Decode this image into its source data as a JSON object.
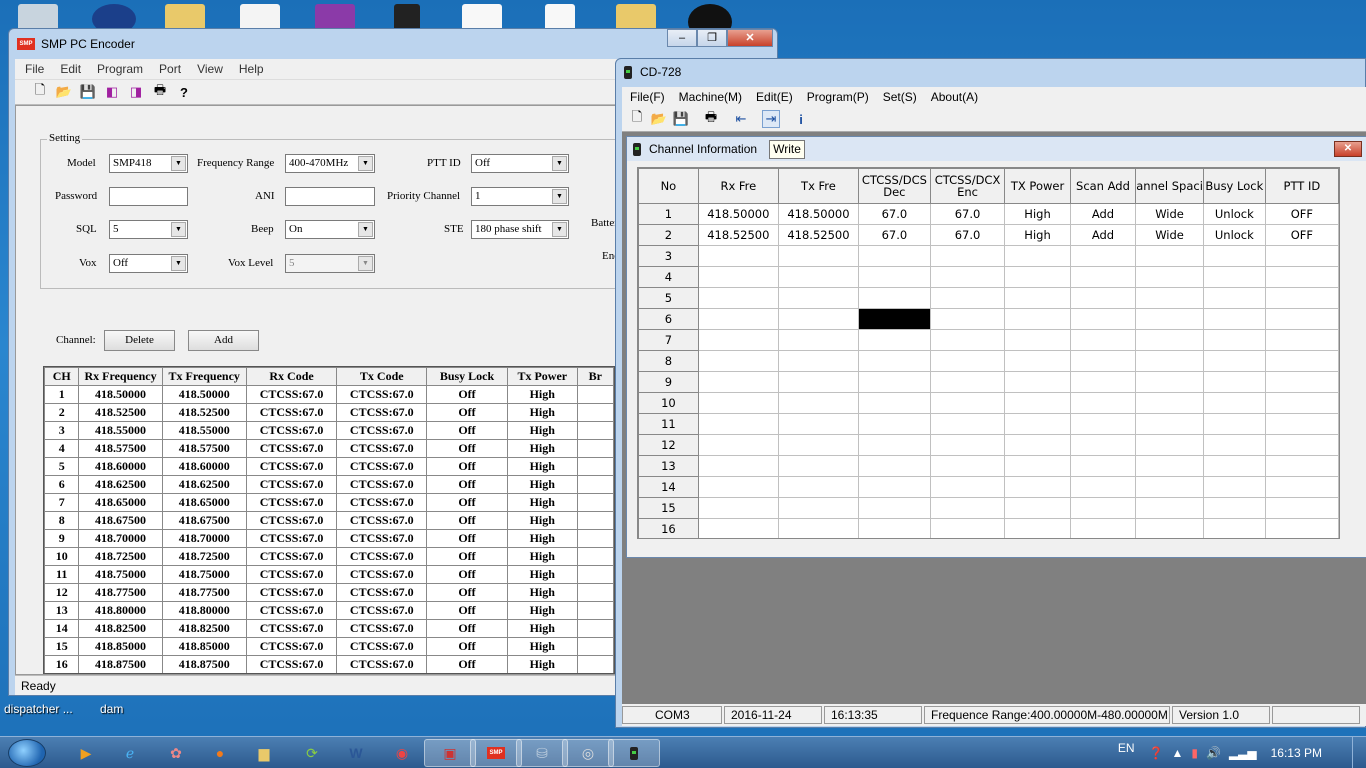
{
  "desktop": {
    "labels": [
      "dispatcher ...",
      "dam"
    ]
  },
  "smp": {
    "title": "SMP PC Encoder",
    "logo": "SMP",
    "menu": [
      "File",
      "Edit",
      "Program",
      "Port",
      "View",
      "Help"
    ],
    "setting_legend": "Setting",
    "model_label": "Model",
    "model_value": "SMP418",
    "freq_label": "Frequency Range",
    "freq_value": "400-470MHz",
    "pttid_label": "PTT ID",
    "pttid_value": "Off",
    "battery_label": "Battery",
    "password_label": "Password",
    "ani_label": "ANI",
    "priority_label": "Priority Channel",
    "priority_value": "1",
    "sql_label": "SQL",
    "sql_value": "5",
    "beep_label": "Beep",
    "beep_value": "On",
    "ste_label": "STE",
    "ste_value": "180 phase shift",
    "end_label": "End",
    "vox_label": "Vox",
    "vox_value": "Off",
    "voxlevel_label": "Vox Level",
    "voxlevel_value": "5",
    "channel_label": "Channel:",
    "delete_label": "Delete",
    "add_label": "Add",
    "columns": [
      "CH",
      "Rx Frequency",
      "Tx Frequency",
      "Rx Code",
      "Tx Code",
      "Busy Lock",
      "Tx Power",
      "Br"
    ],
    "rows": [
      [
        "1",
        "418.50000",
        "418.50000",
        "CTCSS:67.0",
        "CTCSS:67.0",
        "Off",
        "High"
      ],
      [
        "2",
        "418.52500",
        "418.52500",
        "CTCSS:67.0",
        "CTCSS:67.0",
        "Off",
        "High"
      ],
      [
        "3",
        "418.55000",
        "418.55000",
        "CTCSS:67.0",
        "CTCSS:67.0",
        "Off",
        "High"
      ],
      [
        "4",
        "418.57500",
        "418.57500",
        "CTCSS:67.0",
        "CTCSS:67.0",
        "Off",
        "High"
      ],
      [
        "5",
        "418.60000",
        "418.60000",
        "CTCSS:67.0",
        "CTCSS:67.0",
        "Off",
        "High"
      ],
      [
        "6",
        "418.62500",
        "418.62500",
        "CTCSS:67.0",
        "CTCSS:67.0",
        "Off",
        "High"
      ],
      [
        "7",
        "418.65000",
        "418.65000",
        "CTCSS:67.0",
        "CTCSS:67.0",
        "Off",
        "High"
      ],
      [
        "8",
        "418.67500",
        "418.67500",
        "CTCSS:67.0",
        "CTCSS:67.0",
        "Off",
        "High"
      ],
      [
        "9",
        "418.70000",
        "418.70000",
        "CTCSS:67.0",
        "CTCSS:67.0",
        "Off",
        "High"
      ],
      [
        "10",
        "418.72500",
        "418.72500",
        "CTCSS:67.0",
        "CTCSS:67.0",
        "Off",
        "High"
      ],
      [
        "11",
        "418.75000",
        "418.75000",
        "CTCSS:67.0",
        "CTCSS:67.0",
        "Off",
        "High"
      ],
      [
        "12",
        "418.77500",
        "418.77500",
        "CTCSS:67.0",
        "CTCSS:67.0",
        "Off",
        "High"
      ],
      [
        "13",
        "418.80000",
        "418.80000",
        "CTCSS:67.0",
        "CTCSS:67.0",
        "Off",
        "High"
      ],
      [
        "14",
        "418.82500",
        "418.82500",
        "CTCSS:67.0",
        "CTCSS:67.0",
        "Off",
        "High"
      ],
      [
        "15",
        "418.85000",
        "418.85000",
        "CTCSS:67.0",
        "CTCSS:67.0",
        "Off",
        "High"
      ],
      [
        "16",
        "418.87500",
        "418.87500",
        "CTCSS:67.0",
        "CTCSS:67.0",
        "Off",
        "High"
      ]
    ],
    "status": "Ready"
  },
  "cd": {
    "title": "CD-728",
    "menu": [
      "File(F)",
      "Machine(M)",
      "Edit(E)",
      "Program(P)",
      "Set(S)",
      "About(A)"
    ],
    "tooltip": "Write",
    "child_title": "Channel Information",
    "columns": [
      "No",
      "Rx Fre",
      "Tx Fre",
      "CTCSS/DCS Dec",
      "CTCSS/DCX Enc",
      "TX Power",
      "Scan Add",
      "annel Spaci",
      "Busy Lock",
      "PTT ID"
    ],
    "rows": [
      [
        "1",
        "418.50000",
        "418.50000",
        "67.0",
        "67.0",
        "High",
        "Add",
        "Wide",
        "Unlock",
        "OFF"
      ],
      [
        "2",
        "418.52500",
        "418.52500",
        "67.0",
        "67.0",
        "High",
        "Add",
        "Wide",
        "Unlock",
        "OFF"
      ],
      [
        "3"
      ],
      [
        "4"
      ],
      [
        "5"
      ],
      [
        "6"
      ],
      [
        "7"
      ],
      [
        "8"
      ],
      [
        "9"
      ],
      [
        "10"
      ],
      [
        "11"
      ],
      [
        "12"
      ],
      [
        "13"
      ],
      [
        "14"
      ],
      [
        "15"
      ],
      [
        "16"
      ]
    ],
    "status": [
      "COM3",
      "2016-11-24",
      "16:13:35",
      "Frequence Range:400.00000M-480.00000M",
      "Version 1.0"
    ]
  },
  "taskbar": {
    "lang": "EN",
    "time": "16:13 PM",
    "word_icon": "W"
  }
}
